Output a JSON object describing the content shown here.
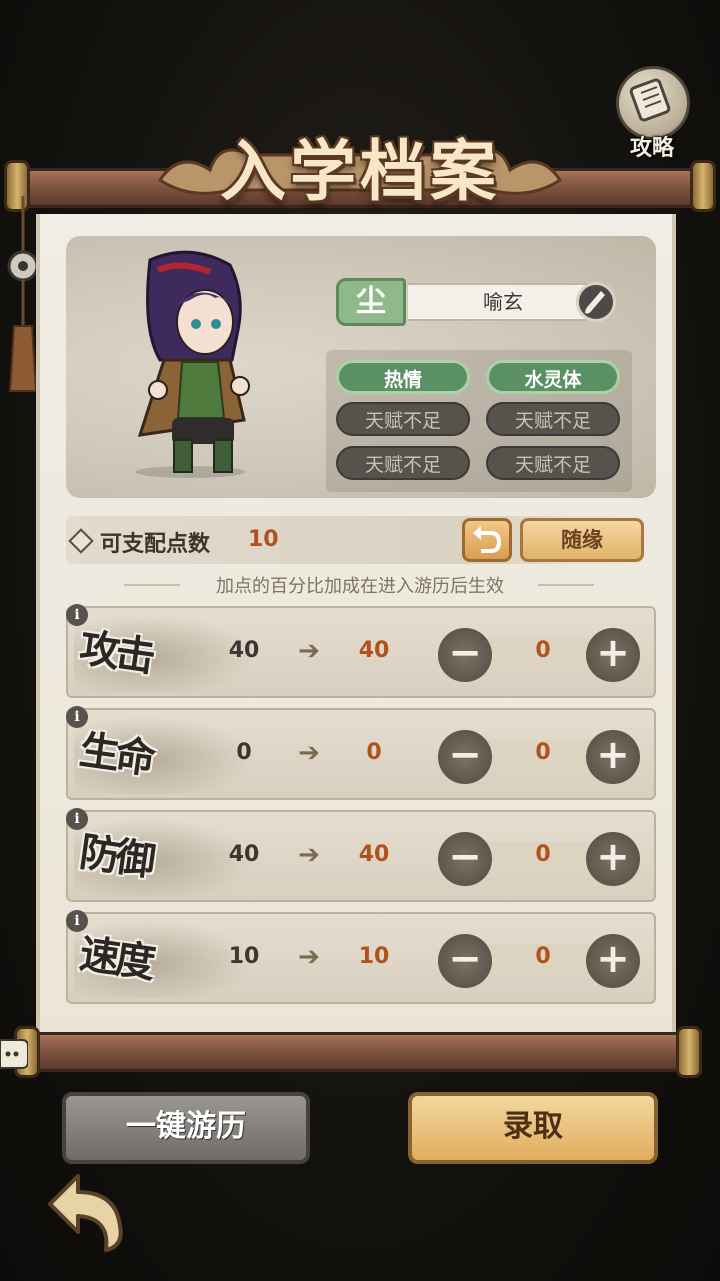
{
  "guide": {
    "label": "攻略"
  },
  "title": "入学档案",
  "character": {
    "rank": "尘",
    "name": "喻玄",
    "traits": [
      {
        "label": "热情",
        "active": true
      },
      {
        "label": "水灵体",
        "active": true
      },
      {
        "label": "天赋不足",
        "active": false
      },
      {
        "label": "天赋不足",
        "active": false
      },
      {
        "label": "天赋不足",
        "active": false
      },
      {
        "label": "天赋不足",
        "active": false
      }
    ]
  },
  "points": {
    "label": "可支配点数",
    "value": "10",
    "random_label": "随缘"
  },
  "note": "加点的百分比加成在进入游历后生效",
  "stats": [
    {
      "name": "攻击",
      "base": "40",
      "arrow": "➔",
      "result": "40",
      "alloc": "0",
      "info": "i",
      "minus": "−",
      "plus": "+"
    },
    {
      "name": "生命",
      "base": "0",
      "arrow": "➔",
      "result": "0",
      "alloc": "0",
      "info": "i",
      "minus": "−",
      "plus": "+"
    },
    {
      "name": "防御",
      "base": "40",
      "arrow": "➔",
      "result": "40",
      "alloc": "0",
      "info": "i",
      "minus": "−",
      "plus": "+"
    },
    {
      "name": "速度",
      "base": "10",
      "arrow": "➔",
      "result": "10",
      "alloc": "0",
      "info": "i",
      "minus": "−",
      "plus": "+"
    }
  ],
  "buttons": {
    "quick_travel": "一键游历",
    "admit": "录取"
  },
  "colors": {
    "accent": "#b0521d",
    "active_trait": "#5a9064",
    "paper": "#f1ede4"
  }
}
